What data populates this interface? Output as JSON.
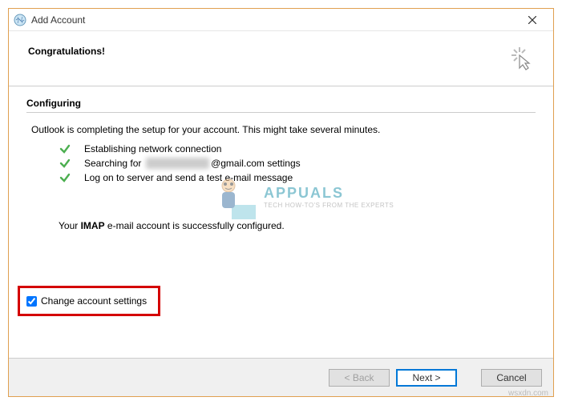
{
  "window": {
    "title": "Add Account",
    "close_tooltip": "Close"
  },
  "header": {
    "congrats": "Congratulations!"
  },
  "section": {
    "title": "Configuring",
    "intro": "Outlook is completing the setup for your account. This might take several minutes."
  },
  "steps": [
    {
      "label": "Establishing network connection"
    },
    {
      "label_pre": "Searching for ",
      "blurred": "xxxxxxxx xxxx",
      "label_post": "@gmail.com settings"
    },
    {
      "label": "Log on to server and send a test e-mail message"
    }
  ],
  "success": {
    "pre": "Your ",
    "bold": "IMAP",
    "post": " e-mail account is successfully configured."
  },
  "watermark": {
    "brand": "APPUALS",
    "tagline": "TECH HOW-TO'S FROM THE EXPERTS"
  },
  "checkbox": {
    "label": "Change account settings",
    "checked": true
  },
  "buttons": {
    "back": "< Back",
    "next": "Next >",
    "cancel": "Cancel"
  },
  "footer_watermark": "wsxdn.com"
}
